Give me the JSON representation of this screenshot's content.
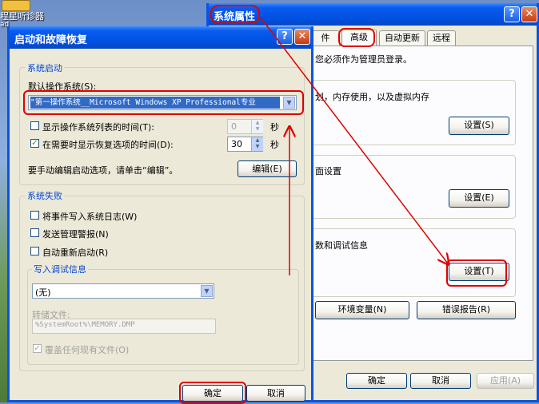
{
  "desktop": {
    "icon_label": "程星听诊器",
    "icon_label2": "ad"
  },
  "sysprops": {
    "title": "系统属性",
    "tabs": [
      "件",
      "高级",
      "自动更新",
      "远程"
    ],
    "admin_note": "您必须作为管理员登录。",
    "perf_text": "划，内存使用，以及虚拟内存",
    "profile_text": "面设置",
    "startup_text": "数和调试信息",
    "settings1": "设置(S)",
    "settings2": "设置(E)",
    "settings3": "设置(T)",
    "env_vars": "环境变量(N)",
    "error_report": "错误报告(R)",
    "ok": "确定",
    "cancel": "取消",
    "apply": "应用(A)"
  },
  "startup": {
    "title": "启动和故障恢复",
    "system_startup_group": "系统启动",
    "default_os_label": "默认操作系统(S):",
    "default_os_value": "\"第一操作系统__Microsoft Windows XP Professional专业",
    "show_list_label": "显示操作系统列表的时间(T):",
    "show_list_value": "0",
    "show_recovery_label": "在需要时显示恢复选项的时间(D):",
    "show_recovery_value": "30",
    "seconds": "秒",
    "edit_hint": "要手动编辑启动选项，请单击“编辑”。",
    "edit_button": "编辑(E)",
    "system_failure_group": "系统失败",
    "write_event": "将事件写入系统日志(W)",
    "send_alert": "发送管理警报(N)",
    "auto_restart": "自动重新启动(R)",
    "debug_group": "写入调试信息",
    "debug_value": "(无)",
    "dump_file_label": "转储文件:",
    "dump_file_value": "%SystemRoot%\\MEMORY.DMP",
    "overwrite": "覆盖任何现有文件(O)",
    "ok": "确定",
    "cancel": "取消"
  },
  "colors": {
    "annotation": "#e00000",
    "titlebar": "#0050e0",
    "group_title": "#0046d5"
  }
}
